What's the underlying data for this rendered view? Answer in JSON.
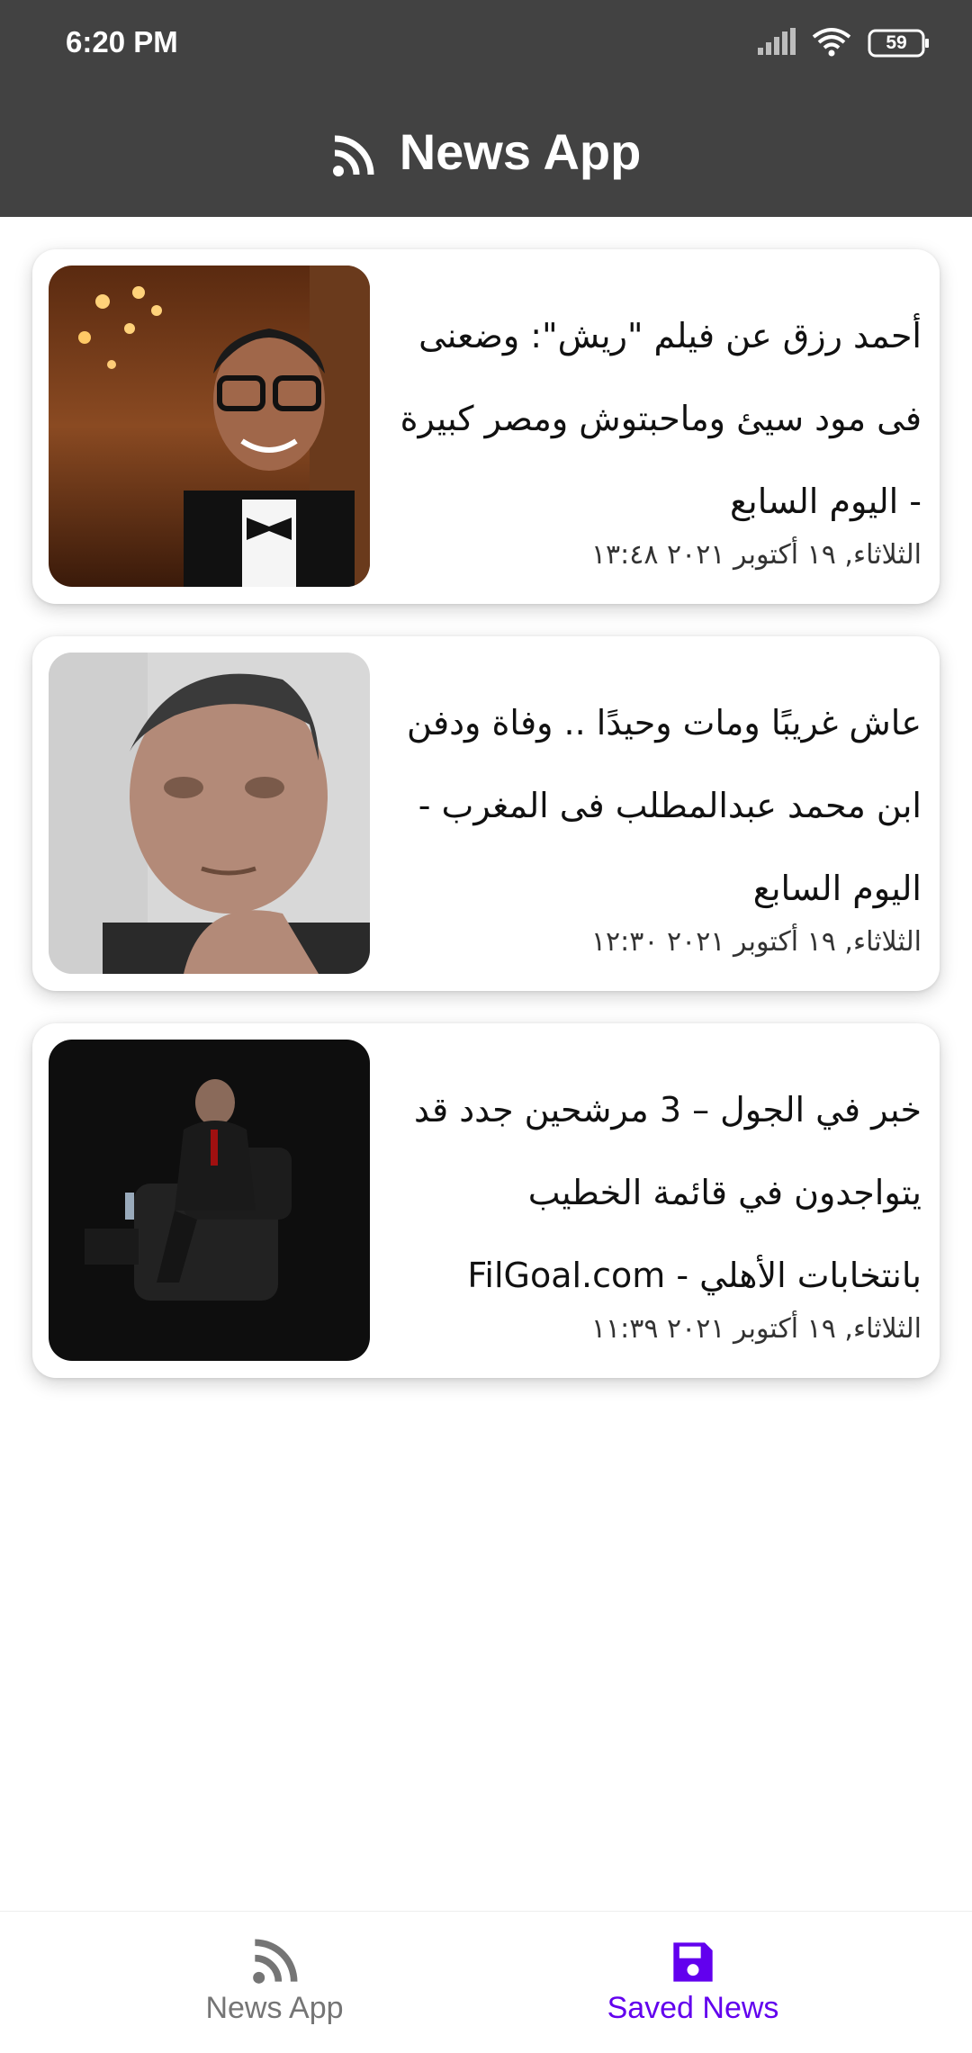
{
  "status_bar": {
    "time": "6:20 PM",
    "battery": "59",
    "icons": [
      "signal-icon",
      "wifi-icon",
      "battery-icon"
    ]
  },
  "app_bar": {
    "title": "News App",
    "icon": "rss-icon"
  },
  "articles": [
    {
      "title": "أحمد رزق عن فيلم \"ريش\": وضعنى فى مود سيئ وماحبتوش ومصر كبيرة - اليوم السابع",
      "date": "الثلاثاء, ١٩ أكتوبر ٢٠٢١ ١٣:٤٨"
    },
    {
      "title": "عاش غريبًا ومات وحيدًا .. وفاة ودفن ابن محمد عبدالمطلب فى المغرب - اليوم السابع",
      "date": "الثلاثاء, ١٩ أكتوبر ٢٠٢١ ١٢:٣٠"
    },
    {
      "title": "خبر في الجول – 3 مرشحين جدد قد يتواجدون في قائمة الخطيب بانتخابات الأهلي - FilGoal.com",
      "date": "الثلاثاء, ١٩ أكتوبر ٢٠٢١ ١١:٣٩"
    }
  ],
  "bottom_nav": {
    "items": [
      {
        "label": "News App",
        "icon": "rss-icon",
        "active": false
      },
      {
        "label": "Saved News",
        "icon": "save-icon",
        "active": true
      }
    ],
    "active_color": "#6200ee",
    "inactive_color": "#757575"
  },
  "colors": {
    "app_bar": "#424242",
    "background": "#ffffff"
  }
}
